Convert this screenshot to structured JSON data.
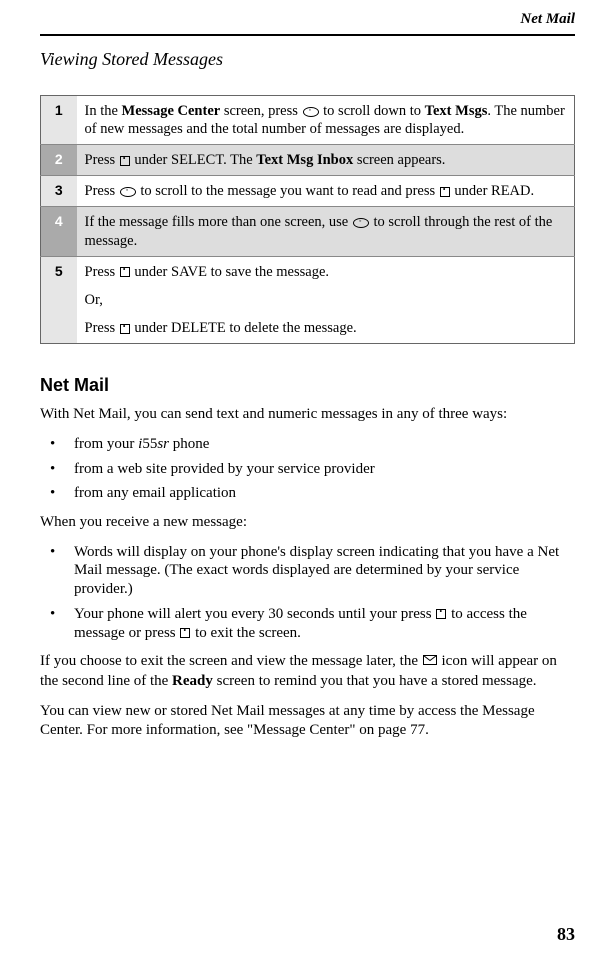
{
  "runningHeader": "Net Mail",
  "sectionHeading": "Viewing Stored Messages",
  "steps": [
    {
      "num": "1",
      "shaded": false,
      "pre1": "In the ",
      "bold1": "Message Center",
      "mid1": " screen, press ",
      "icon1": "scroll",
      "mid2": " to scroll down to ",
      "bold2": "Text Msgs",
      "post": ". The number of new messages and the total number of messages are displayed."
    },
    {
      "num": "2",
      "shaded": true,
      "pre1": "Press ",
      "icon1": "key",
      "mid1": " under SELECT. The ",
      "bold1": "Text Msg Inbox",
      "post": " screen appears."
    },
    {
      "num": "3",
      "shaded": false,
      "pre1": "Press ",
      "icon1": "scroll",
      "mid1": " to scroll to the message you want to read and press  ",
      "icon2": "key",
      "post": " under READ."
    },
    {
      "num": "4",
      "shaded": true,
      "pre1": "If the message fills more than one screen, use ",
      "icon1": "scroll",
      "post": " to scroll through the rest of the message."
    },
    {
      "num": "5",
      "shaded": false,
      "paras": [
        {
          "pre": "Press  ",
          "icon": "key",
          "post": " under SAVE to save the message."
        },
        {
          "text": "Or,"
        },
        {
          "pre": "Press  ",
          "icon": "key",
          "post": " under DELETE to delete the message."
        }
      ]
    }
  ],
  "topicHeading": "Net Mail",
  "intro": "With Net Mail, you can send text and numeric messages in any of three ways:",
  "ways": {
    "way1_pre": "from your ",
    "way1_model_i": "i",
    "way1_model_num": "55",
    "way1_model_sr": "sr",
    "way1_post": " phone",
    "way2": "from a web site provided by your service provider",
    "way3": "from any email application"
  },
  "receiveIntro": "When you receive a new message:",
  "receiveBullets": {
    "b1": "Words will display on your phone's display screen indicating that you have a Net Mail message. (The exact words displayed are determined by your service provider.)",
    "b2_pre": "Your phone will alert you every 30 seconds until your press  ",
    "b2_mid": " to access the message or press  ",
    "b2_post": " to exit the screen."
  },
  "exitPara": {
    "pre": "If you choose to exit the screen and view the message later, the ",
    "mid": "  icon will appear on the second line of the ",
    "bold": "Ready",
    "post": " screen to remind you that you have a stored message."
  },
  "viewPara": "You can view new or stored Net Mail messages at any time by access the Message Center. For more information, see \"Message Center\" on page 77.",
  "pageNumber": "83"
}
